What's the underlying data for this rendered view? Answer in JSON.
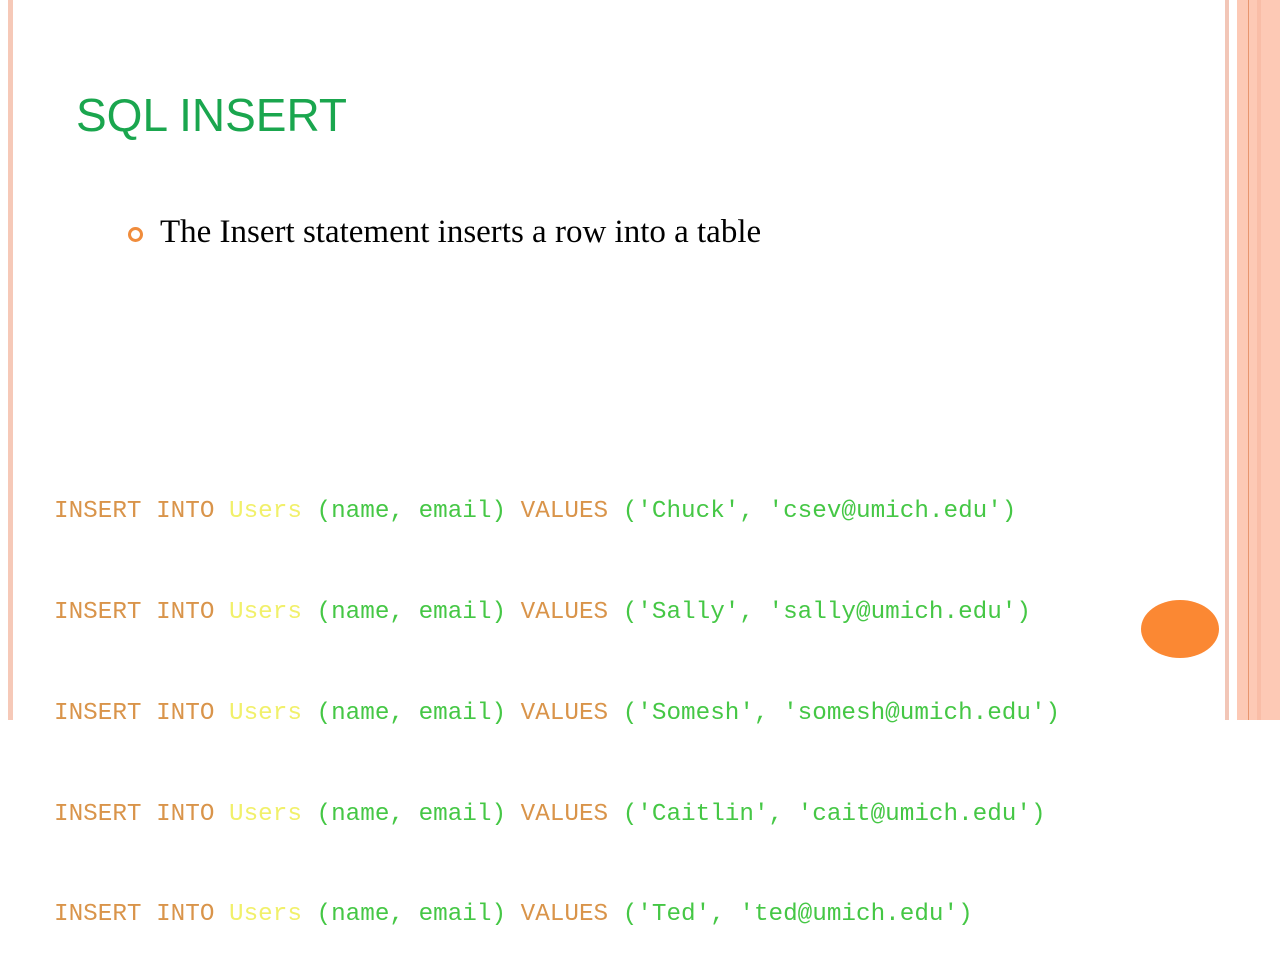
{
  "slide": {
    "title": "SQL INSERT",
    "bullets": [
      {
        "icon": "hollow-circle-bullet-icon",
        "text": "The Insert statement inserts a row into a table"
      }
    ],
    "code_lines": [
      {
        "kw1": "INSERT",
        "kw2": "INTO",
        "table": "Users",
        "columns": "(name, email)",
        "kw3": "VALUES",
        "values": "('Chuck', 'csev@umich.edu')"
      },
      {
        "kw1": "INSERT",
        "kw2": "INTO",
        "table": "Users",
        "columns": "(name, email)",
        "kw3": "VALUES",
        "values": "('Sally', 'sally@umich.edu')"
      },
      {
        "kw1": "INSERT",
        "kw2": "INTO",
        "table": "Users",
        "columns": "(name, email)",
        "kw3": "VALUES",
        "values": "('Somesh', 'somesh@umich.edu')"
      },
      {
        "kw1": "INSERT",
        "kw2": "INTO",
        "table": "Users",
        "columns": "(name, email)",
        "kw3": "VALUES",
        "values": "('Caitlin', 'cait@umich.edu')"
      },
      {
        "kw1": "INSERT",
        "kw2": "INTO",
        "table": "Users",
        "columns": "(name, email)",
        "kw3": "VALUES",
        "values": "('Ted', 'ted@umich.edu')"
      }
    ],
    "colors": {
      "title": "#1aa64e",
      "keyword": "#d9944a",
      "table": "#f1f06a",
      "columns_values": "#45c745",
      "accent": "#fb8833",
      "border": "#fdc9b5"
    }
  }
}
